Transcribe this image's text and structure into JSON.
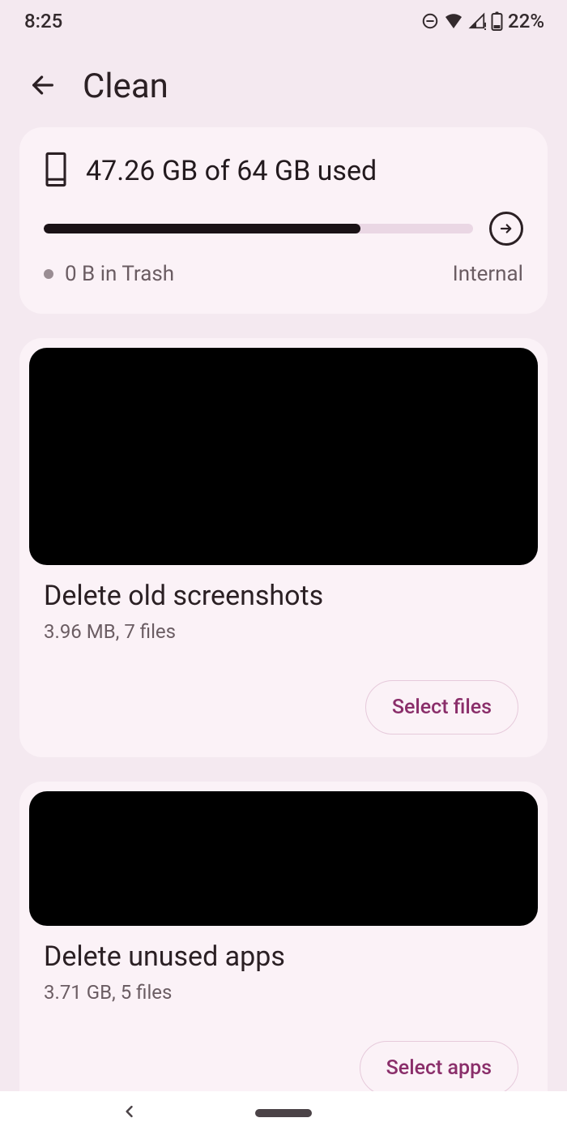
{
  "status": {
    "time": "8:25",
    "battery": "22%"
  },
  "appbar": {
    "title": "Clean"
  },
  "storage": {
    "summary": "47.26 GB of 64 GB used",
    "progress_percent": 73.8,
    "trash": "0 B in Trash",
    "type": "Internal"
  },
  "cards": [
    {
      "title": "Delete old screenshots",
      "subtitle": "3.96 MB, 7 files",
      "action": "Select files"
    },
    {
      "title": "Delete unused apps",
      "subtitle": "3.71 GB, 5 files",
      "action": "Select apps"
    }
  ]
}
